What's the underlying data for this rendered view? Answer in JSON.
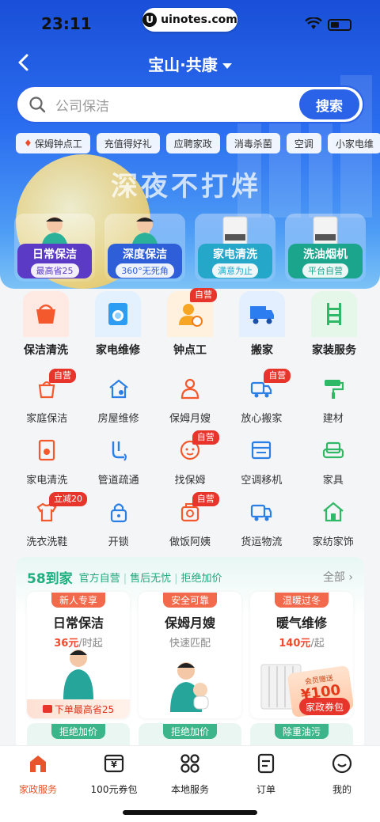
{
  "status_bar": {
    "time": "23:11",
    "site": "uinotes.com"
  },
  "header": {
    "location": "宝山·共康"
  },
  "search": {
    "placeholder": "公司保洁",
    "button": "搜索"
  },
  "quick_tags": [
    "保姆钟点工",
    "充值得好礼",
    "应聘家政",
    "消毒杀菌",
    "空调",
    "小家电维"
  ],
  "banner": {
    "slogan": "深夜不打烊",
    "cards": [
      {
        "title": "日常保洁",
        "sub": "最高省25",
        "color": "#5b3ac6"
      },
      {
        "title": "深度保洁",
        "sub": "360°无死角",
        "color": "#2e5fd9"
      },
      {
        "title": "家电清洗",
        "sub": "满意为止",
        "color": "#25a7c9"
      },
      {
        "title": "洗油烟机",
        "sub": "平台自营",
        "color": "#1aa58c"
      }
    ]
  },
  "main_categories": [
    {
      "label": "保洁清洗",
      "icon": "bucket-icon",
      "color": "#ffe9e2"
    },
    {
      "label": "家电维修",
      "icon": "washer-icon",
      "color": "#e3f1ff"
    },
    {
      "label": "钟点工",
      "icon": "worker-clock-icon",
      "color": "#fff1de",
      "badge": "自营"
    },
    {
      "label": "搬家",
      "icon": "truck-icon",
      "color": "#e3efff"
    },
    {
      "label": "家装服务",
      "icon": "ladder-icon",
      "color": "#e4f7e8"
    }
  ],
  "sub_categories": [
    {
      "label": "家庭保洁",
      "icon": "bucket-small-icon",
      "badge": "自营"
    },
    {
      "label": "房屋维修",
      "icon": "house-wrench-icon"
    },
    {
      "label": "保姆月嫂",
      "icon": "nanny-icon"
    },
    {
      "label": "放心搬家",
      "icon": "moving-truck-icon",
      "badge": "自营"
    },
    {
      "label": "建材",
      "icon": "paint-roller-icon"
    },
    {
      "label": "家电清洗",
      "icon": "appliance-icon"
    },
    {
      "label": "管道疏通",
      "icon": "pipe-icon"
    },
    {
      "label": "找保姆",
      "icon": "baby-face-icon",
      "badge": "自营"
    },
    {
      "label": "空调移机",
      "icon": "air-conditioner-icon"
    },
    {
      "label": "家具",
      "icon": "sofa-icon"
    },
    {
      "label": "洗衣洗鞋",
      "icon": "tshirt-icon",
      "badge": "立减20"
    },
    {
      "label": "开锁",
      "icon": "lock-icon"
    },
    {
      "label": "做饭阿姨",
      "icon": "chef-icon",
      "badge": "自营"
    },
    {
      "label": "货运物流",
      "icon": "cargo-truck-icon"
    },
    {
      "label": "家纺家饰",
      "icon": "home-decor-icon"
    }
  ],
  "promo": {
    "brand": "58到家",
    "tags": [
      "官方自营",
      "售后无忧",
      "拒绝加价"
    ],
    "more": "全部",
    "cards": [
      {
        "ribbon": "新人专享",
        "title": "日常保洁",
        "price": "36元",
        "unit": "/时起",
        "foot": "下单最高省25",
        "ribbon_color": "#f26a4b"
      },
      {
        "ribbon": "安全可靠",
        "title": "保姆月嫂",
        "sub": "快速匹配",
        "ribbon_color": "#f26a4b"
      },
      {
        "ribbon": "温暖过冬",
        "title": "暖气维修",
        "price": "140元",
        "unit": "/起",
        "coupon_top": "会员赠送",
        "coupon_amount": "¥100",
        "coupon_btn": "家政券包",
        "ribbon_color": "#f26a4b"
      }
    ],
    "row2": [
      "拒绝加价",
      "拒绝加价",
      "除重油污"
    ]
  },
  "tabbar": [
    {
      "label": "家政服务",
      "icon": "home-service-icon",
      "active": true
    },
    {
      "label": "100元券包",
      "icon": "coupon-icon"
    },
    {
      "label": "本地服务",
      "icon": "grid-icon"
    },
    {
      "label": "订单",
      "icon": "order-icon"
    },
    {
      "label": "我的",
      "icon": "smile-icon"
    }
  ]
}
